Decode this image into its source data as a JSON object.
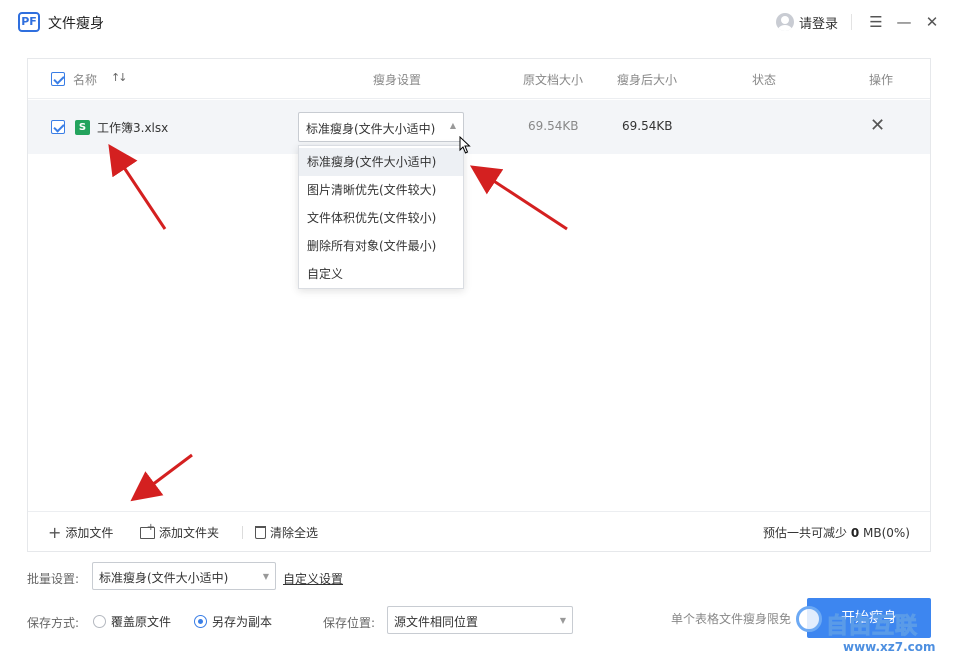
{
  "app": {
    "logo_text": "PF",
    "title": "文件瘦身"
  },
  "titlebar": {
    "login_label": "请登录",
    "menu_glyph": "☰",
    "minimize_glyph": "—",
    "close_glyph": "✕"
  },
  "table": {
    "headers": {
      "name": "名称",
      "sort": "↑↓",
      "setting": "瘦身设置",
      "orig_size": "原文档大小",
      "new_size": "瘦身后大小",
      "status": "状态",
      "action": "操作"
    },
    "rows": [
      {
        "file_icon_letter": "S",
        "file_name": "工作簿3.xlsx",
        "setting": "标准瘦身(文件大小适中)",
        "orig_size": "69.54KB",
        "new_size": "69.54KB",
        "status": "",
        "close_glyph": "✕"
      }
    ]
  },
  "dropdown": {
    "options": [
      "标准瘦身(文件大小适中)",
      "图片清晰优先(文件较大)",
      "文件体积优先(文件较小)",
      "删除所有对象(文件最小)",
      "自定义"
    ],
    "highlighted_index": 0
  },
  "footer": {
    "add_file": "添加文件",
    "add_folder": "添加文件夹",
    "clear_all": "清除全选",
    "estimate_prefix": "预估一共可减少",
    "estimate_value": "0",
    "estimate_suffix": "MB(0%)"
  },
  "batch": {
    "label": "批量设置:",
    "value": "标准瘦身(文件大小适中)",
    "custom_link": "自定义设置"
  },
  "save": {
    "mode_label": "保存方式:",
    "option_overwrite": "覆盖原文件",
    "option_copy": "另存为副本",
    "selected": "copy",
    "location_label": "保存位置:",
    "location_value": "源文件相同位置",
    "limit_note": "单个表格文件瘦身限免",
    "start_button": "开始瘦身"
  },
  "watermark": {
    "text": "自由互联",
    "url": "www.xz7.com"
  },
  "colors": {
    "accent": "#3d86f0",
    "arrow": "#d42020",
    "file_icon": "#23a35d"
  }
}
